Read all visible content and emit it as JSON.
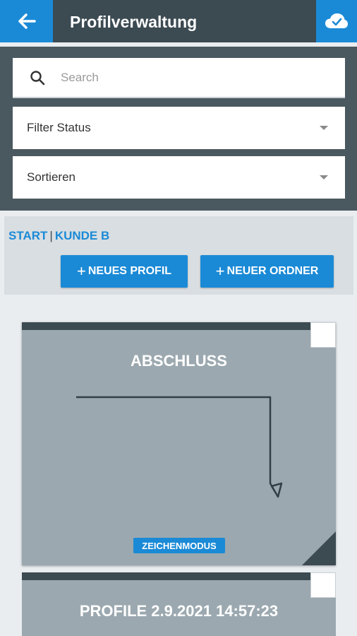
{
  "header": {
    "title": "Profilverwaltung",
    "back_icon": "arrow-left-icon",
    "cloud_icon": "cloud-check-icon",
    "accent_color": "#1b8ad6",
    "bar_color": "#3c4a52"
  },
  "filters": {
    "search_placeholder": "Search",
    "search_value": "",
    "status_label": "Filter Status",
    "sort_label": "Sortieren"
  },
  "breadcrumb": {
    "items": [
      "START",
      "KUNDE B"
    ],
    "separator": "|"
  },
  "actions": {
    "new_profile": "NEUES PROFIL",
    "new_folder": "NEUER ORDNER"
  },
  "cards": [
    {
      "title": "ABSCHLUSS",
      "mode": "ZEICHENMODUS"
    },
    {
      "title": "PROFILE 2.9.2021 14:57:23"
    }
  ]
}
